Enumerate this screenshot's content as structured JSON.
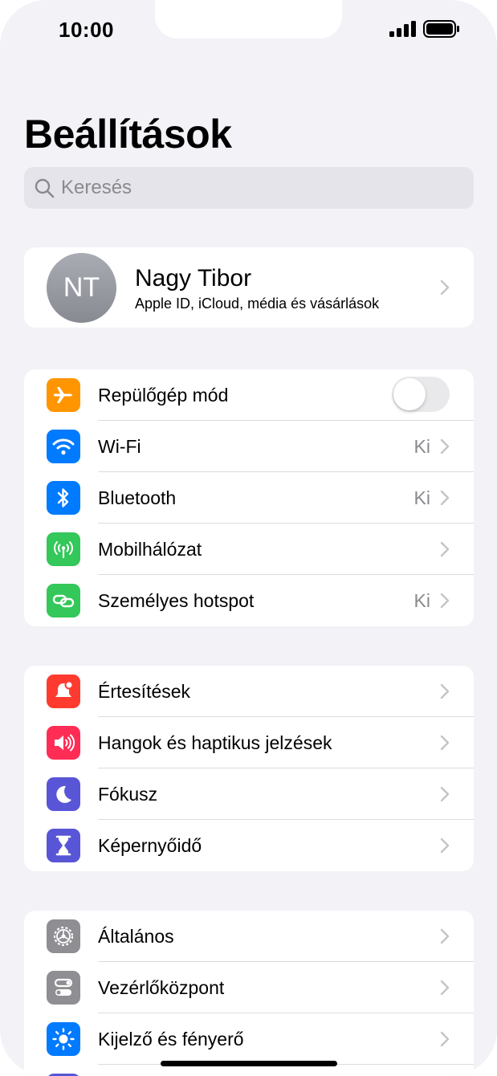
{
  "status": {
    "time": "10:00"
  },
  "page": {
    "title": "Beállítások"
  },
  "search": {
    "placeholder": "Keresés"
  },
  "profile": {
    "initials": "NT",
    "name": "Nagy Tibor",
    "subtitle": "Apple ID, iCloud, média és vásárlások"
  },
  "groups": [
    {
      "items": [
        {
          "label": "Repülőgép mód",
          "icon": "airplane-icon",
          "color": "#ff9500",
          "toggle": "off"
        },
        {
          "label": "Wi-Fi",
          "icon": "wifi-icon",
          "color": "#007aff",
          "value": "Ki"
        },
        {
          "label": "Bluetooth",
          "icon": "bluetooth-icon",
          "color": "#007aff",
          "value": "Ki"
        },
        {
          "label": "Mobilhálózat",
          "icon": "antenna-icon",
          "color": "#34c759",
          "value": ""
        },
        {
          "label": "Személyes hotspot",
          "icon": "hotspot-icon",
          "color": "#34c759",
          "value": "Ki"
        }
      ]
    },
    {
      "items": [
        {
          "label": "Értesítések",
          "icon": "bell-icon",
          "color": "#ff3b30"
        },
        {
          "label": "Hangok és haptikus jelzések",
          "icon": "speaker-icon",
          "color": "#ff2d55"
        },
        {
          "label": "Fókusz",
          "icon": "moon-icon",
          "color": "#5856d6"
        },
        {
          "label": "Képernyőidő",
          "icon": "hourglass-icon",
          "color": "#5856d6"
        }
      ]
    },
    {
      "items": [
        {
          "label": "Általános",
          "icon": "gear-icon",
          "color": "#8e8e93"
        },
        {
          "label": "Vezérlőközpont",
          "icon": "switches-icon",
          "color": "#8e8e93"
        },
        {
          "label": "Kijelző és fényerő",
          "icon": "sun-icon",
          "color": "#007aff"
        }
      ]
    }
  ]
}
